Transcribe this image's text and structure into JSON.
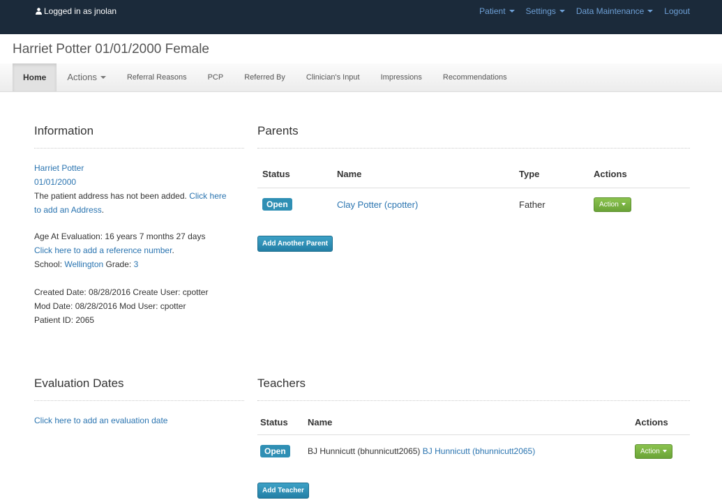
{
  "topbar": {
    "logged_in": "Logged in as jnolan",
    "nav": [
      {
        "label": "Patient"
      },
      {
        "label": "Settings"
      },
      {
        "label": "Data Maintenance"
      },
      {
        "label": "Logout"
      }
    ]
  },
  "patient": {
    "title": "Harriet Potter 01/01/2000 Female"
  },
  "tabs": [
    "Home",
    "Actions",
    "Referral Reasons",
    "PCP",
    "Referred By",
    "Clinician's Input",
    "Impressions",
    "Recommendations"
  ],
  "information": {
    "heading": "Information",
    "name": "Harriet Potter",
    "dob": "01/01/2000",
    "address_text": "The patient address has not been added.",
    "address_link_1": "Click here",
    "address_link_2": "to add an Address",
    "address_period": ".",
    "age": "Age At Evaluation: 16 years 7 months 27 days",
    "ref_link": "Click here to add a reference number",
    "ref_period": ".",
    "school_label": "School:",
    "school_value": "Wellington",
    "grade_label": "Grade:",
    "grade_value": "3",
    "created": "Created Date: 08/28/2016 Create User: cpotter",
    "modified": "Mod Date: 08/28/2016 Mod User: cpotter",
    "patient_id": "Patient ID: 2065"
  },
  "parents": {
    "heading": "Parents",
    "columns": [
      "Status",
      "Name",
      "Type",
      "Actions"
    ],
    "rows": [
      {
        "status": "Open",
        "name": "Clay Potter (cpotter)",
        "type": "Father",
        "action": "Action"
      }
    ],
    "add_button": "Add Another Parent"
  },
  "evaluation": {
    "heading": "Evaluation Dates",
    "link": "Click here to add an evaluation date"
  },
  "teachers": {
    "heading": "Teachers",
    "columns": [
      "Status",
      "Name",
      "Actions"
    ],
    "rows": [
      {
        "status": "Open",
        "name_plain": "BJ Hunnicutt (bhunnicutt2065)",
        "name_link": "BJ Hunnicutt (bhunnicutt2065)",
        "action": "Action"
      }
    ],
    "add_button": "Add Teacher"
  }
}
